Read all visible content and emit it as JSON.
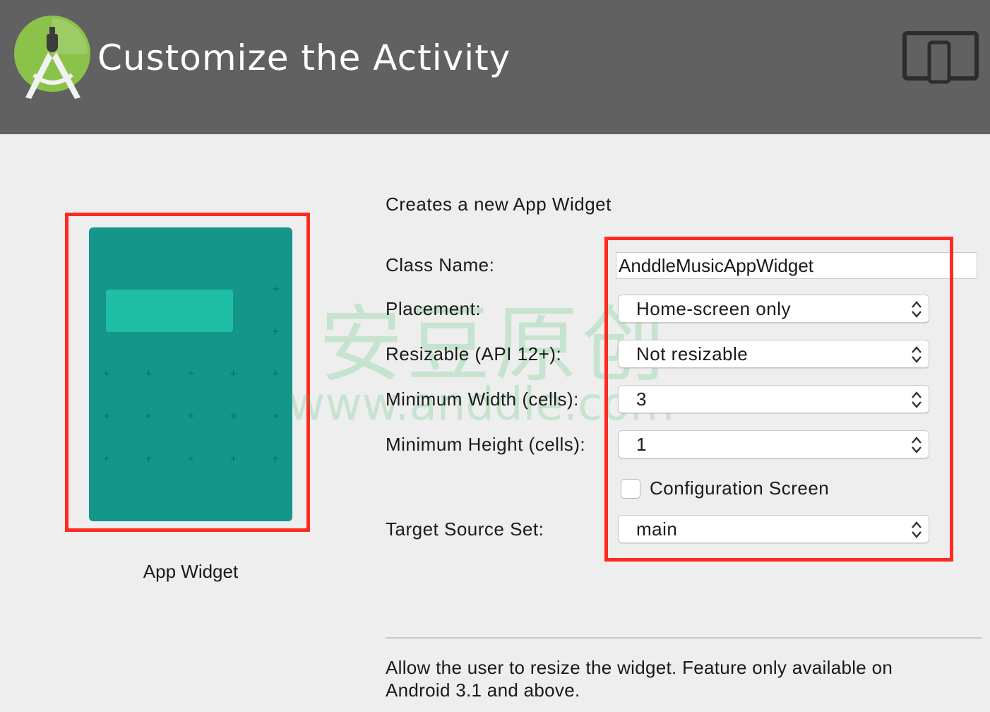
{
  "header": {
    "title": "Customize the Activity",
    "logo_icon": "android-studio-logo-icon",
    "device_icon": "tablet-phone-icon",
    "background": "#616161"
  },
  "preview": {
    "caption": "App Widget",
    "widget_color": "#14968a",
    "bar_color": "#1fbfa6",
    "highlight_color": "#ff2a1f"
  },
  "form": {
    "description": "Creates a new App Widget",
    "class_name": {
      "label": "Class Name:",
      "value": "AnddleMusicAppWidget"
    },
    "placement": {
      "label": "Placement:",
      "value": "Home-screen only"
    },
    "resizable": {
      "label": "Resizable (API 12+):",
      "value": "Not resizable"
    },
    "min_width": {
      "label": "Minimum Width (cells):",
      "value": "3"
    },
    "min_height": {
      "label": "Minimum Height (cells):",
      "value": "1"
    },
    "configuration": {
      "label": "Configuration Screen",
      "checked": false
    },
    "source_set": {
      "label": "Target Source Set:",
      "value": "main"
    }
  },
  "help_text": "Allow the user to resize the widget. Feature only available on Android 3.1 and above.",
  "watermark": {
    "chinese": "安豆原创",
    "url": "www.anddle.com"
  }
}
